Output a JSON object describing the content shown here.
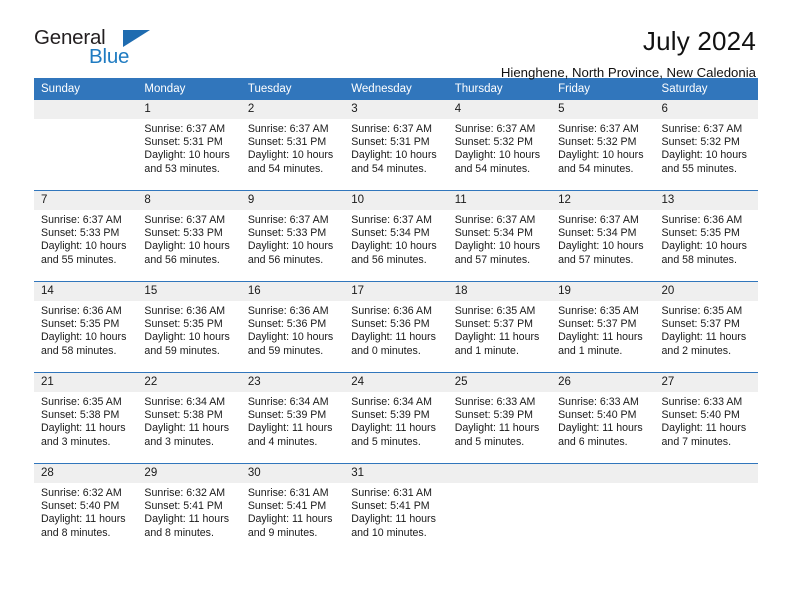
{
  "brand": {
    "name_part1": "General",
    "name_part2": "Blue",
    "logo_icon": "triangle-logo-icon",
    "accent_color": "#1f7bc1"
  },
  "header": {
    "title": "July 2024",
    "subtitle": "Hienghene, North Province, New Caledonia"
  },
  "theme": {
    "header_row_color": "#3176bc",
    "daynum_band_color": "#efefef",
    "text_color": "#1a1a1a"
  },
  "calendar": {
    "weekday_headers": [
      "Sunday",
      "Monday",
      "Tuesday",
      "Wednesday",
      "Thursday",
      "Friday",
      "Saturday"
    ],
    "weeks": [
      [
        {
          "day": "",
          "empty": true,
          "sunrise": "",
          "sunset": "",
          "daylight_line1": "",
          "daylight_line2": ""
        },
        {
          "day": "1",
          "sunrise": "Sunrise: 6:37 AM",
          "sunset": "Sunset: 5:31 PM",
          "daylight_line1": "Daylight: 10 hours",
          "daylight_line2": "and 53 minutes."
        },
        {
          "day": "2",
          "sunrise": "Sunrise: 6:37 AM",
          "sunset": "Sunset: 5:31 PM",
          "daylight_line1": "Daylight: 10 hours",
          "daylight_line2": "and 54 minutes."
        },
        {
          "day": "3",
          "sunrise": "Sunrise: 6:37 AM",
          "sunset": "Sunset: 5:31 PM",
          "daylight_line1": "Daylight: 10 hours",
          "daylight_line2": "and 54 minutes."
        },
        {
          "day": "4",
          "sunrise": "Sunrise: 6:37 AM",
          "sunset": "Sunset: 5:32 PM",
          "daylight_line1": "Daylight: 10 hours",
          "daylight_line2": "and 54 minutes."
        },
        {
          "day": "5",
          "sunrise": "Sunrise: 6:37 AM",
          "sunset": "Sunset: 5:32 PM",
          "daylight_line1": "Daylight: 10 hours",
          "daylight_line2": "and 54 minutes."
        },
        {
          "day": "6",
          "sunrise": "Sunrise: 6:37 AM",
          "sunset": "Sunset: 5:32 PM",
          "daylight_line1": "Daylight: 10 hours",
          "daylight_line2": "and 55 minutes."
        }
      ],
      [
        {
          "day": "7",
          "sunrise": "Sunrise: 6:37 AM",
          "sunset": "Sunset: 5:33 PM",
          "daylight_line1": "Daylight: 10 hours",
          "daylight_line2": "and 55 minutes."
        },
        {
          "day": "8",
          "sunrise": "Sunrise: 6:37 AM",
          "sunset": "Sunset: 5:33 PM",
          "daylight_line1": "Daylight: 10 hours",
          "daylight_line2": "and 56 minutes."
        },
        {
          "day": "9",
          "sunrise": "Sunrise: 6:37 AM",
          "sunset": "Sunset: 5:33 PM",
          "daylight_line1": "Daylight: 10 hours",
          "daylight_line2": "and 56 minutes."
        },
        {
          "day": "10",
          "sunrise": "Sunrise: 6:37 AM",
          "sunset": "Sunset: 5:34 PM",
          "daylight_line1": "Daylight: 10 hours",
          "daylight_line2": "and 56 minutes."
        },
        {
          "day": "11",
          "sunrise": "Sunrise: 6:37 AM",
          "sunset": "Sunset: 5:34 PM",
          "daylight_line1": "Daylight: 10 hours",
          "daylight_line2": "and 57 minutes."
        },
        {
          "day": "12",
          "sunrise": "Sunrise: 6:37 AM",
          "sunset": "Sunset: 5:34 PM",
          "daylight_line1": "Daylight: 10 hours",
          "daylight_line2": "and 57 minutes."
        },
        {
          "day": "13",
          "sunrise": "Sunrise: 6:36 AM",
          "sunset": "Sunset: 5:35 PM",
          "daylight_line1": "Daylight: 10 hours",
          "daylight_line2": "and 58 minutes."
        }
      ],
      [
        {
          "day": "14",
          "sunrise": "Sunrise: 6:36 AM",
          "sunset": "Sunset: 5:35 PM",
          "daylight_line1": "Daylight: 10 hours",
          "daylight_line2": "and 58 minutes."
        },
        {
          "day": "15",
          "sunrise": "Sunrise: 6:36 AM",
          "sunset": "Sunset: 5:35 PM",
          "daylight_line1": "Daylight: 10 hours",
          "daylight_line2": "and 59 minutes."
        },
        {
          "day": "16",
          "sunrise": "Sunrise: 6:36 AM",
          "sunset": "Sunset: 5:36 PM",
          "daylight_line1": "Daylight: 10 hours",
          "daylight_line2": "and 59 minutes."
        },
        {
          "day": "17",
          "sunrise": "Sunrise: 6:36 AM",
          "sunset": "Sunset: 5:36 PM",
          "daylight_line1": "Daylight: 11 hours",
          "daylight_line2": "and 0 minutes."
        },
        {
          "day": "18",
          "sunrise": "Sunrise: 6:35 AM",
          "sunset": "Sunset: 5:37 PM",
          "daylight_line1": "Daylight: 11 hours",
          "daylight_line2": "and 1 minute."
        },
        {
          "day": "19",
          "sunrise": "Sunrise: 6:35 AM",
          "sunset": "Sunset: 5:37 PM",
          "daylight_line1": "Daylight: 11 hours",
          "daylight_line2": "and 1 minute."
        },
        {
          "day": "20",
          "sunrise": "Sunrise: 6:35 AM",
          "sunset": "Sunset: 5:37 PM",
          "daylight_line1": "Daylight: 11 hours",
          "daylight_line2": "and 2 minutes."
        }
      ],
      [
        {
          "day": "21",
          "sunrise": "Sunrise: 6:35 AM",
          "sunset": "Sunset: 5:38 PM",
          "daylight_line1": "Daylight: 11 hours",
          "daylight_line2": "and 3 minutes."
        },
        {
          "day": "22",
          "sunrise": "Sunrise: 6:34 AM",
          "sunset": "Sunset: 5:38 PM",
          "daylight_line1": "Daylight: 11 hours",
          "daylight_line2": "and 3 minutes."
        },
        {
          "day": "23",
          "sunrise": "Sunrise: 6:34 AM",
          "sunset": "Sunset: 5:39 PM",
          "daylight_line1": "Daylight: 11 hours",
          "daylight_line2": "and 4 minutes."
        },
        {
          "day": "24",
          "sunrise": "Sunrise: 6:34 AM",
          "sunset": "Sunset: 5:39 PM",
          "daylight_line1": "Daylight: 11 hours",
          "daylight_line2": "and 5 minutes."
        },
        {
          "day": "25",
          "sunrise": "Sunrise: 6:33 AM",
          "sunset": "Sunset: 5:39 PM",
          "daylight_line1": "Daylight: 11 hours",
          "daylight_line2": "and 5 minutes."
        },
        {
          "day": "26",
          "sunrise": "Sunrise: 6:33 AM",
          "sunset": "Sunset: 5:40 PM",
          "daylight_line1": "Daylight: 11 hours",
          "daylight_line2": "and 6 minutes."
        },
        {
          "day": "27",
          "sunrise": "Sunrise: 6:33 AM",
          "sunset": "Sunset: 5:40 PM",
          "daylight_line1": "Daylight: 11 hours",
          "daylight_line2": "and 7 minutes."
        }
      ],
      [
        {
          "day": "28",
          "sunrise": "Sunrise: 6:32 AM",
          "sunset": "Sunset: 5:40 PM",
          "daylight_line1": "Daylight: 11 hours",
          "daylight_line2": "and 8 minutes."
        },
        {
          "day": "29",
          "sunrise": "Sunrise: 6:32 AM",
          "sunset": "Sunset: 5:41 PM",
          "daylight_line1": "Daylight: 11 hours",
          "daylight_line2": "and 8 minutes."
        },
        {
          "day": "30",
          "sunrise": "Sunrise: 6:31 AM",
          "sunset": "Sunset: 5:41 PM",
          "daylight_line1": "Daylight: 11 hours",
          "daylight_line2": "and 9 minutes."
        },
        {
          "day": "31",
          "sunrise": "Sunrise: 6:31 AM",
          "sunset": "Sunset: 5:41 PM",
          "daylight_line1": "Daylight: 11 hours",
          "daylight_line2": "and 10 minutes."
        },
        {
          "day": "",
          "empty": true,
          "sunrise": "",
          "sunset": "",
          "daylight_line1": "",
          "daylight_line2": ""
        },
        {
          "day": "",
          "empty": true,
          "sunrise": "",
          "sunset": "",
          "daylight_line1": "",
          "daylight_line2": ""
        },
        {
          "day": "",
          "empty": true,
          "sunrise": "",
          "sunset": "",
          "daylight_line1": "",
          "daylight_line2": ""
        }
      ]
    ]
  }
}
